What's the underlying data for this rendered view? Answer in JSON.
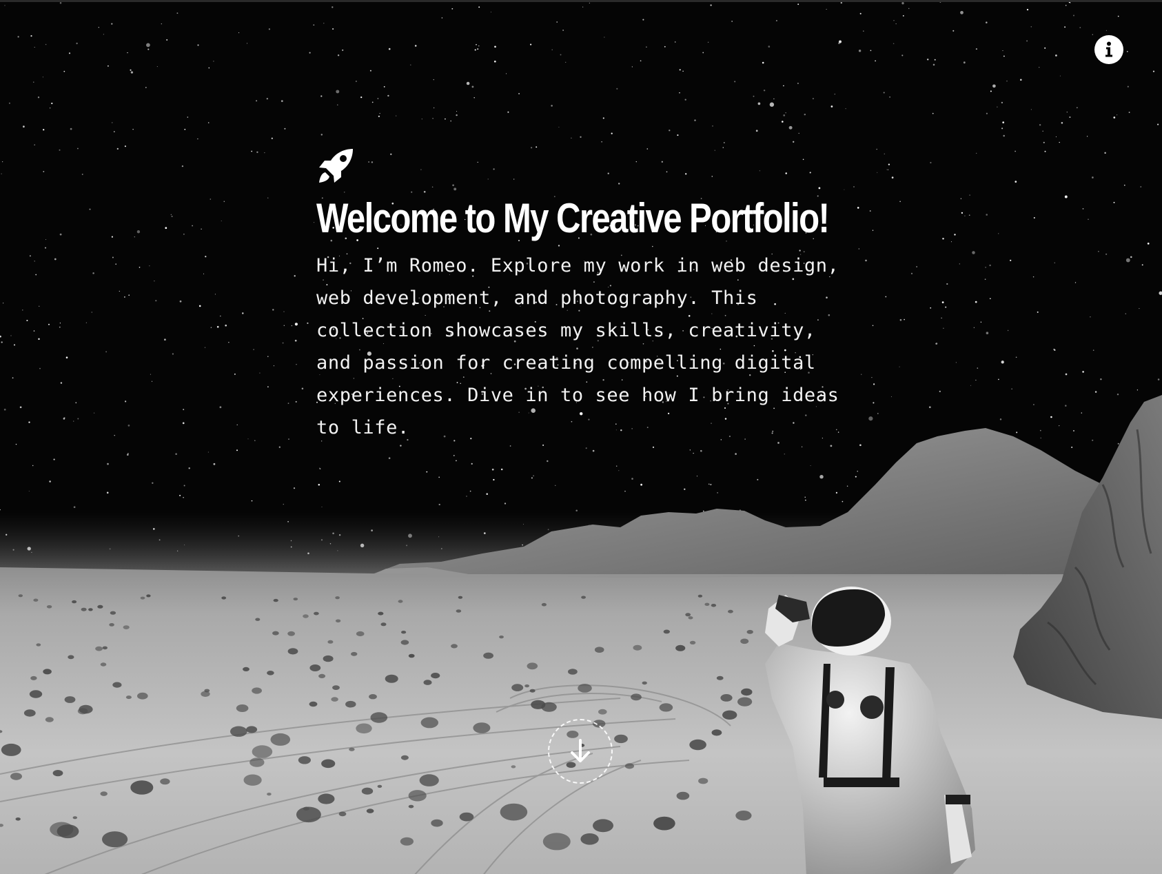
{
  "hero": {
    "title": "Welcome to My Creative Portfolio!",
    "intro": "Hi, I’m Romeo. Explore my work in web design, web development, and photography. This collection showcases my skills, creativity, and passion for creating compelling digital experiences. Dive in to see how I bring ideas to life."
  },
  "icons": {
    "info": "info-icon",
    "rocket": "rocket-icon",
    "scroll": "arrow-down-icon"
  },
  "colors": {
    "sky": "#050505",
    "text": "#ffffff",
    "sand": "#bdbdbd",
    "rock": "#8c8c8c"
  }
}
